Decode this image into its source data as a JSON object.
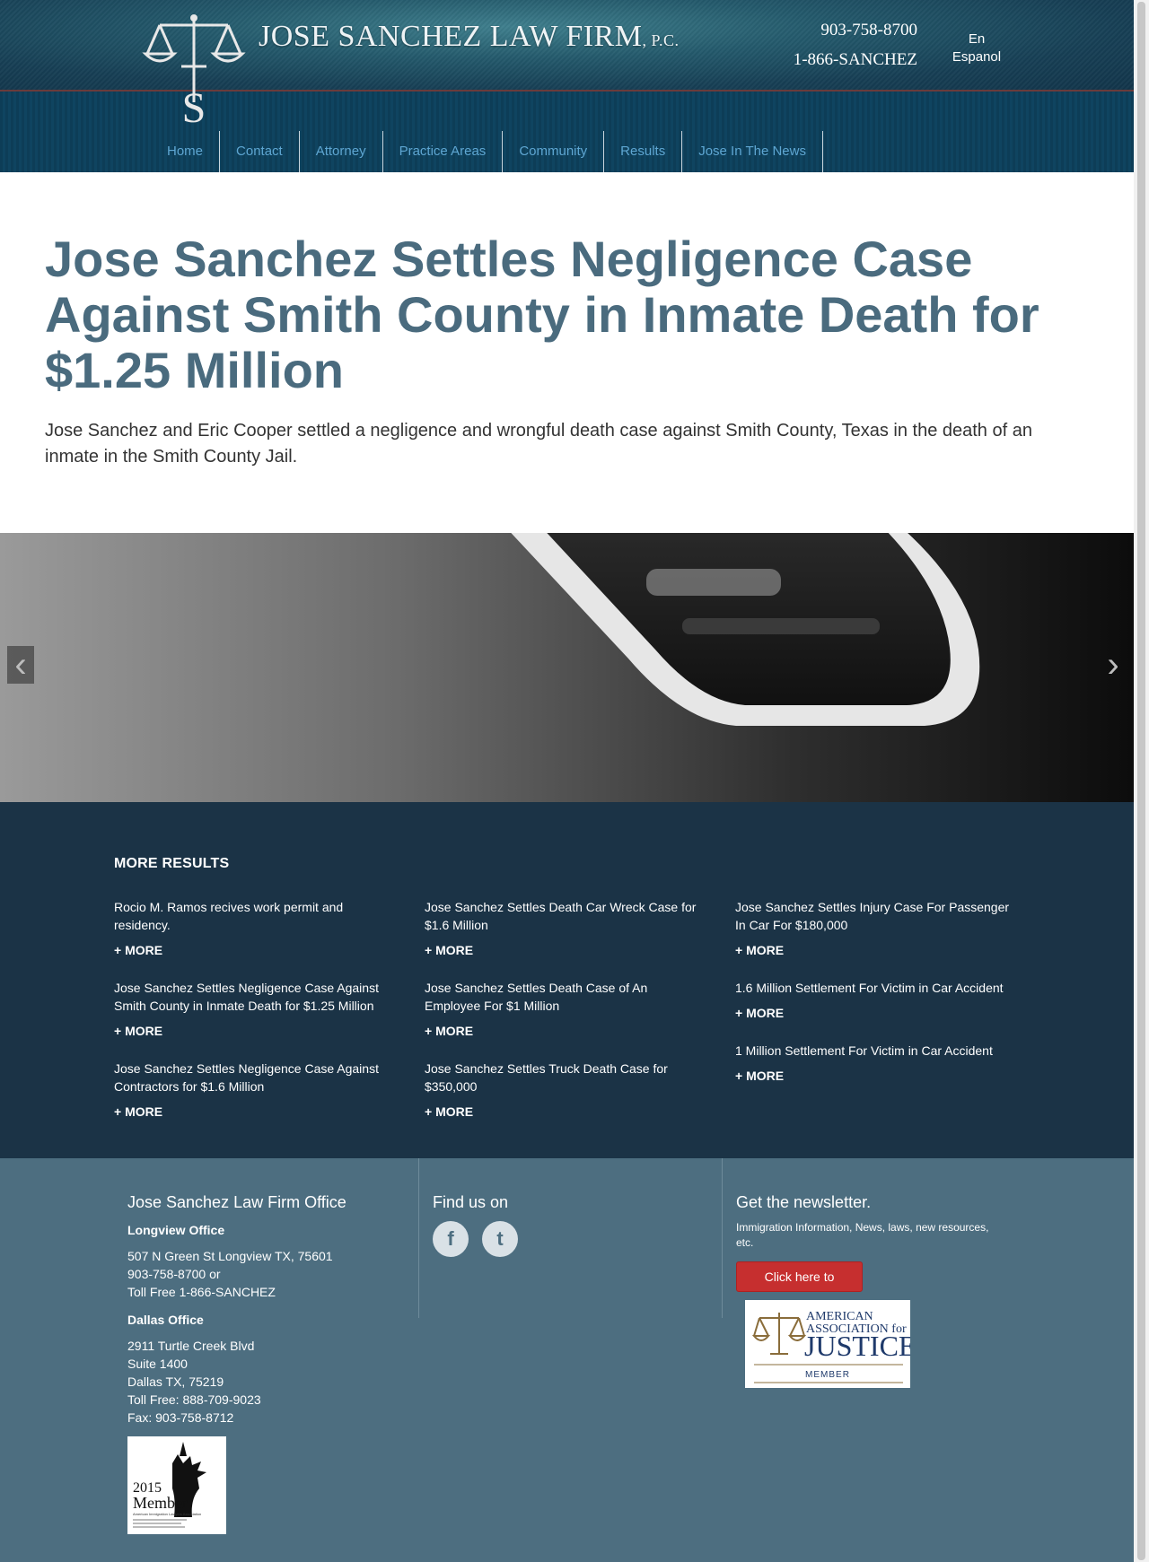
{
  "header": {
    "brand": "JOSE SANCHEZ LAW FIRM",
    "brand_suffix": "P.C.",
    "phone_local": "903-758-8700",
    "phone_toll": "1-866-SANCHEZ",
    "lang_en": "En",
    "lang_es": "Espanol"
  },
  "nav": [
    "Home",
    "Contact",
    "Attorney",
    "Practice Areas",
    "Community",
    "Results",
    "Jose In The News"
  ],
  "article": {
    "title": "Jose Sanchez Settles Negligence Case Against Smith County in Inmate Death for $1.25 Million",
    "lede": "Jose Sanchez and Eric Cooper settled a negligence and wrongful death case against Smith County, Texas in the death of an inmate in the Smith County Jail."
  },
  "slider": {
    "prev": "‹",
    "next": "›"
  },
  "more_results": {
    "heading": "MORE RESULTS",
    "more_label": "+ MORE",
    "items": [
      "Rocio M. Ramos recives work permit and residency.",
      "Jose Sanchez Settles Death Car Wreck Case for $1.6 Million",
      "Jose Sanchez Settles Injury Case For Passenger In Car For $180,000",
      "Jose Sanchez Settles Negligence Case Against Smith County in Inmate Death for $1.25 Million",
      "Jose Sanchez Settles Death Case of An Employee For $1 Million",
      "1.6 Million Settlement For Victim in Car Accident",
      "Jose Sanchez Settles Negligence Case Against Contractors for $1.6 Million",
      "Jose Sanchez Settles Truck Death Case for $350,000",
      "1 Million Settlement For Victim in Car Accident"
    ]
  },
  "footer": {
    "office_heading": "Jose Sanchez Law Firm Office",
    "longview_heading": "Longview Office",
    "longview_lines": [
      "507 N Green St Longview TX, 75601",
      "903-758-8700 or",
      "Toll Free 1-866-SANCHEZ"
    ],
    "dallas_heading": "Dallas Office",
    "dallas_lines": [
      "2911 Turtle Creek Blvd",
      "Suite 1400",
      "Dallas TX, 75219",
      "Toll Free: 888-709-9023",
      "Fax: 903-758-8712"
    ],
    "find_heading": "Find us on",
    "facebook_icon": "f",
    "twitter_icon": "t",
    "newsletter_heading": "Get the newsletter.",
    "newsletter_text": "Immigration Information, News, laws, new resources, etc.",
    "subscribe_label": "Click here to subscribe",
    "aila_year": "2015",
    "aila_member": "Member",
    "aila_org": "American Immigration Lawyers Association",
    "aaj_line1": "AMERICAN",
    "aaj_line2": "ASSOCIATION for",
    "aaj_line3": "JUSTICE",
    "aaj_line4": "MEMBER"
  },
  "colors": {
    "header_teal": "#245a6c",
    "nav_link": "#5ea6d2",
    "title": "#4a6b7e",
    "results_bg": "#1b3346",
    "footer_bg": "#4d6e80",
    "subscribe": "#c62f2f"
  }
}
